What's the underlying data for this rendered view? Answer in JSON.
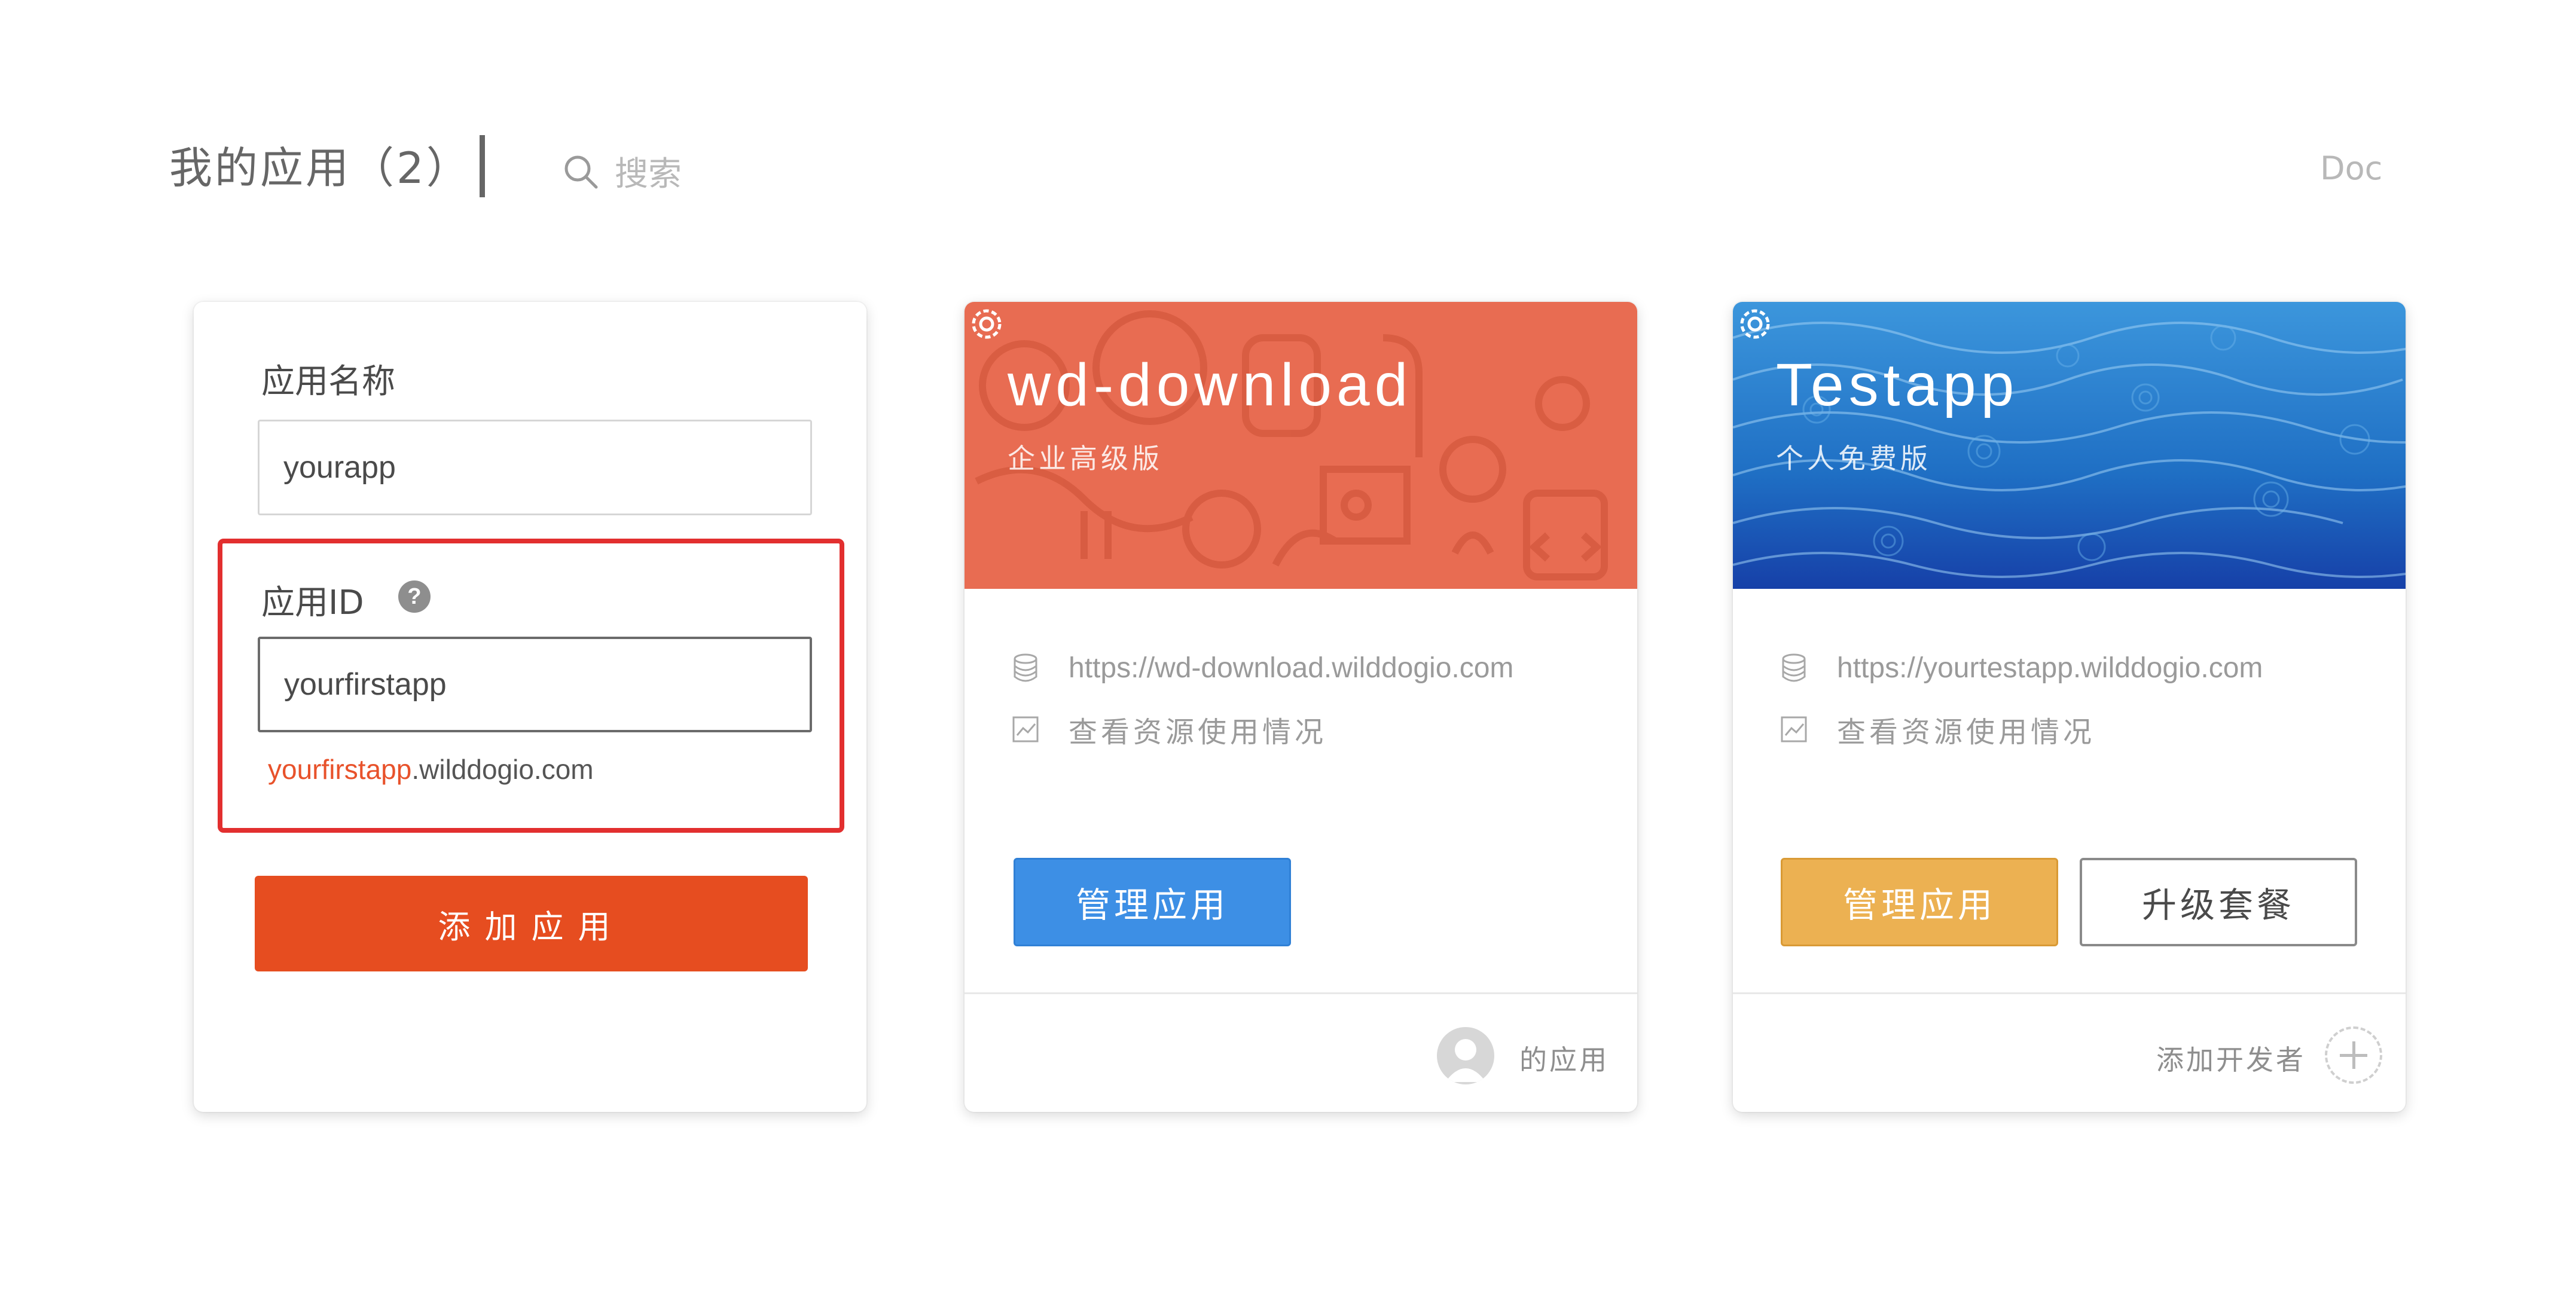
{
  "header": {
    "title": "我的应用（2）",
    "search_label": "搜索",
    "doc_link": "Doc"
  },
  "new_app_form": {
    "name_label": "应用名称",
    "name_value": "yourapp",
    "id_label": "应用ID",
    "id_value": "yourfirstapp",
    "domain_preview_subdomain": "yourfirstapp",
    "domain_preview_suffix": ".wilddogio.com",
    "add_button": "添加应用",
    "help_icon": "question-icon"
  },
  "apps": [
    {
      "name": "wd-download",
      "plan": "企业高级版",
      "url": "https://wd-download.wilddogio.com",
      "usage_link": "查看资源使用情况",
      "manage_button": "管理应用",
      "footer_text": "的应用",
      "banner_color": "#e86c52",
      "button_color": "#3d8fe5"
    },
    {
      "name": "Testapp",
      "plan": "个人免费版",
      "url": "https://yourtestapp.wilddogio.com",
      "usage_link": "查看资源使用情况",
      "manage_button": "管理应用",
      "upgrade_button": "升级套餐",
      "footer_text": "添加开发者",
      "banner_color": "#1f6fc4",
      "button_color": "#ecb152"
    }
  ],
  "colors": {
    "accent": "#e64d20",
    "highlight_border": "#e22f2f",
    "domain_highlight": "#e8522b"
  }
}
